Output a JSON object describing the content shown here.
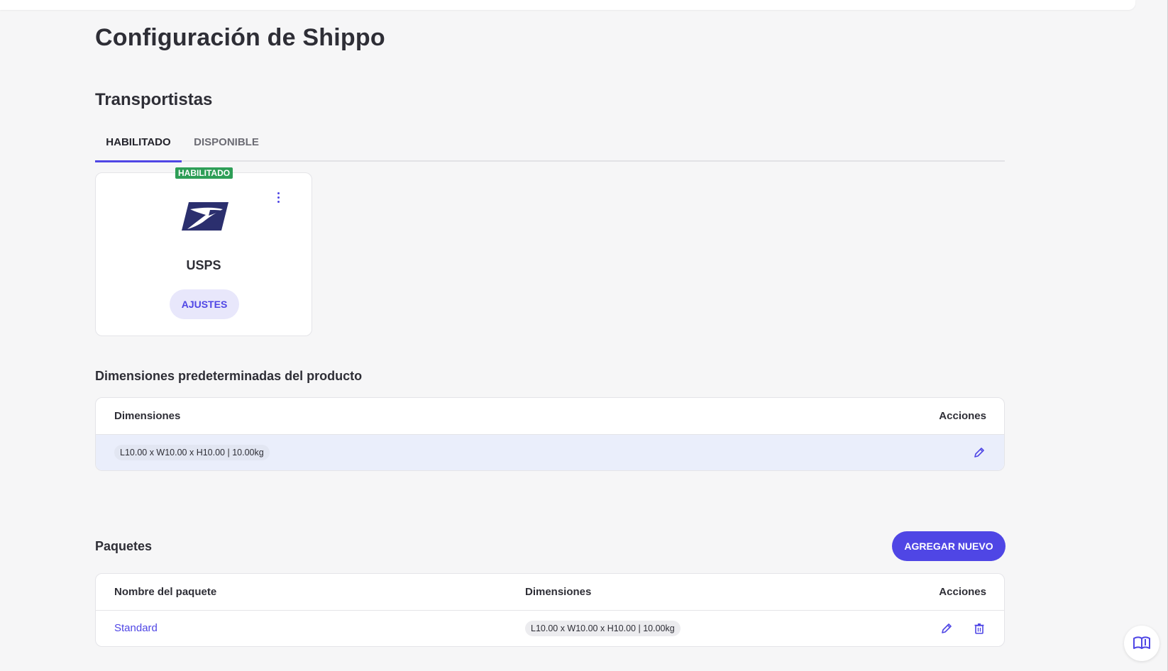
{
  "page": {
    "title": "Configuración de Shippo"
  },
  "carriers": {
    "title": "Transportistas",
    "tabs": [
      {
        "label": "HABILITADO",
        "active": true
      },
      {
        "label": "DISPONIBLE",
        "active": false
      }
    ],
    "card": {
      "badge": "HABILITADO",
      "name": "USPS",
      "settings_label": "AJUSTES",
      "logo_icon": "usps-eagle-logo",
      "menu_icon": "kebab-menu-icon"
    }
  },
  "default_dimensions": {
    "title": "Dimensiones predeterminadas del producto",
    "headers": {
      "dimensions": "Dimensiones",
      "actions": "Acciones"
    },
    "rows": [
      {
        "dimensions": "L10.00 x W10.00 x H10.00 | 10.00kg"
      }
    ]
  },
  "packages": {
    "title": "Paquetes",
    "add_label": "AGREGAR NUEVO",
    "headers": {
      "name": "Nombre del paquete",
      "dimensions": "Dimensiones",
      "actions": "Acciones"
    },
    "rows": [
      {
        "name": "Standard",
        "dimensions": "L10.00 x W10.00 x H10.00 | 10.00kg"
      }
    ]
  },
  "colors": {
    "accent": "#4f46e5",
    "badge_green": "#2e9e57",
    "logo_navy": "#2b2f6e",
    "background": "#f6f6f7"
  },
  "help": {
    "icon": "book-help-icon"
  }
}
